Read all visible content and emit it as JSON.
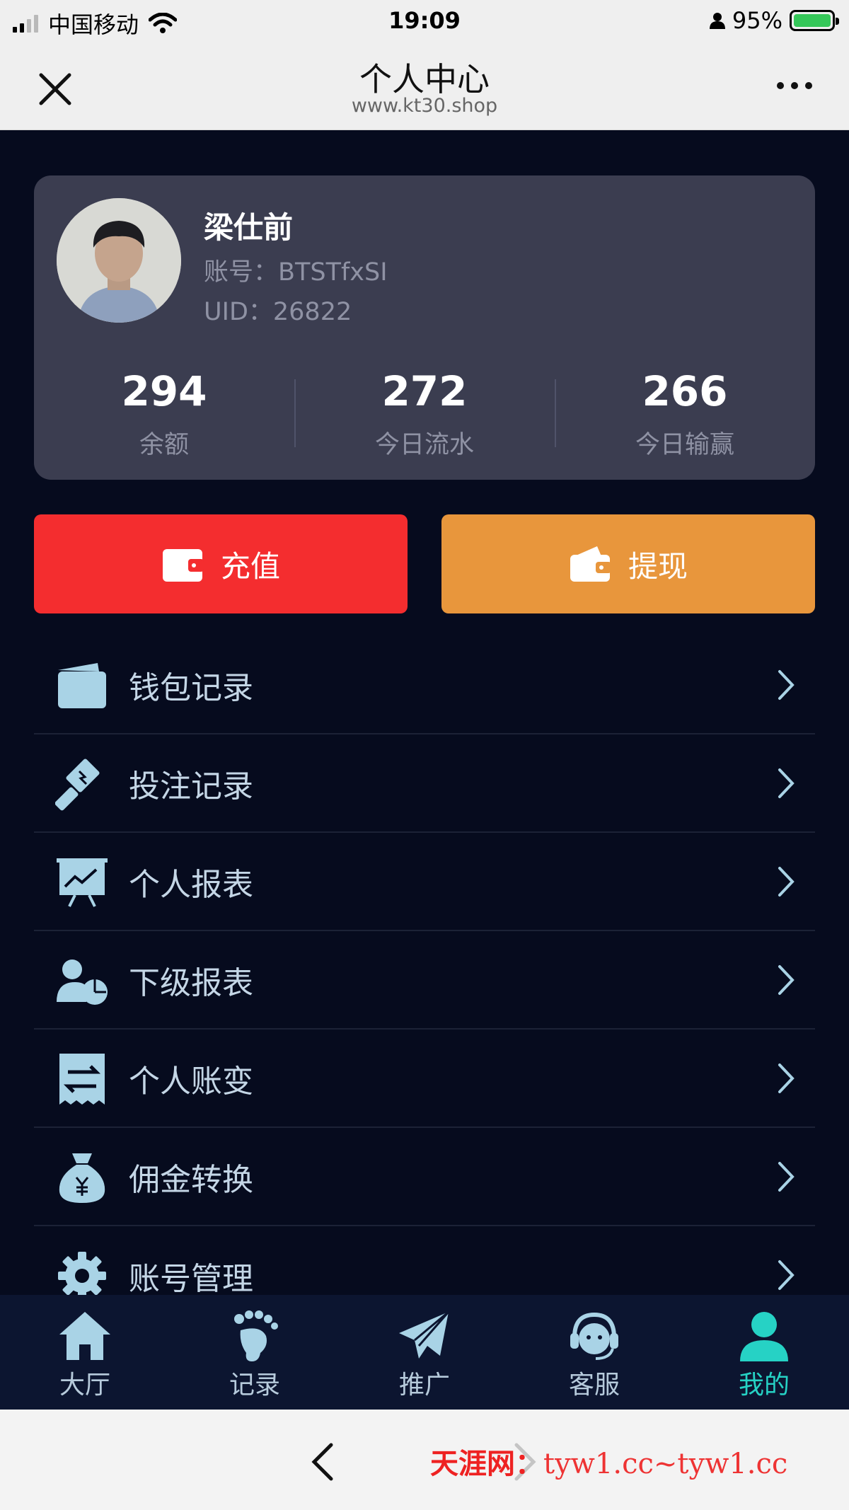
{
  "status_bar": {
    "carrier": "中国移动",
    "time": "19:09",
    "battery": "95%"
  },
  "nav": {
    "title": "个人中心",
    "url": "www.kt30.shop"
  },
  "profile": {
    "name": "梁仕前",
    "account": "账号：BTSTfxSI",
    "uid": "UID：26822",
    "stats": [
      {
        "value": "294",
        "label": "余额"
      },
      {
        "value": "272",
        "label": "今日流水"
      },
      {
        "value": "266",
        "label": "今日输赢"
      }
    ]
  },
  "actions": {
    "recharge": "充值",
    "withdraw": "提现"
  },
  "menu": [
    {
      "label": "钱包记录",
      "icon": "wallet-icon"
    },
    {
      "label": "投注记录",
      "icon": "gavel-icon"
    },
    {
      "label": "个人报表",
      "icon": "chart-board-icon"
    },
    {
      "label": "下级报表",
      "icon": "user-pie-icon"
    },
    {
      "label": "个人账变",
      "icon": "receipt-exchange-icon"
    },
    {
      "label": "佣金转换",
      "icon": "money-bag-icon"
    },
    {
      "label": "账号管理",
      "icon": "gear-icon"
    }
  ],
  "tabs": [
    {
      "label": "大厅",
      "icon": "home-icon"
    },
    {
      "label": "记录",
      "icon": "footprint-icon"
    },
    {
      "label": "推广",
      "icon": "paper-plane-icon"
    },
    {
      "label": "客服",
      "icon": "headset-icon"
    },
    {
      "label": "我的",
      "icon": "user-icon",
      "active": true
    }
  ],
  "watermark": {
    "site": "天涯网：",
    "url": "tyw1.cc~tyw1.cc"
  },
  "colors": {
    "background": "#060b1e",
    "card": "#3b3d50",
    "recharge": "#f42d2f",
    "withdraw": "#e8963c",
    "icon": "#a9d3e6",
    "active_tab": "#26d2c5"
  }
}
